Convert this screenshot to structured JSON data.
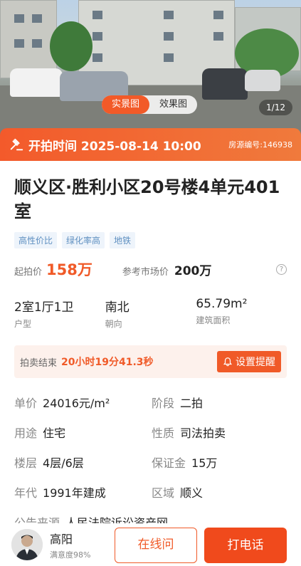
{
  "gallery": {
    "tabs": [
      "实景图",
      "效果图"
    ],
    "active_tab": "实景图",
    "counter": "1/12"
  },
  "auction": {
    "start_label": "开拍时间",
    "start_time": "2025-08-14 10:00",
    "listing_id": "房源编号:146938"
  },
  "listing": {
    "title": "顺义区·胜利小区20号楼4单元401室",
    "tags": [
      "高性价比",
      "绿化率高",
      "地铁"
    ]
  },
  "price": {
    "start_label": "起拍价",
    "start_value": "158万",
    "ref_label": "参考市场价",
    "ref_value": "200万",
    "color": "#f05a28"
  },
  "specs": [
    {
      "value": "2室1厅1卫",
      "label": "户型"
    },
    {
      "value": "南北",
      "label": "朝向"
    },
    {
      "value": "65.79m²",
      "label": "建筑面积"
    }
  ],
  "countdown": {
    "label": "拍卖结束",
    "value": "20小时19分41.3秒",
    "remind_label": "设置提醒"
  },
  "details": [
    {
      "key": "单价",
      "value": "24016元/m²"
    },
    {
      "key": "阶段",
      "value": "二拍"
    },
    {
      "key": "用途",
      "value": "住宅"
    },
    {
      "key": "性质",
      "value": "司法拍卖"
    },
    {
      "key": "楼层",
      "value": "4层/6层"
    },
    {
      "key": "保证金",
      "value": "15万"
    },
    {
      "key": "年代",
      "value": "1991年建成"
    },
    {
      "key": "区域",
      "value": "顺义"
    }
  ],
  "notice_source": {
    "key": "公告来源",
    "value": "人民法院诉讼资产网"
  },
  "agent": {
    "name": "高阳",
    "satisfaction": "满意度98%"
  },
  "actions": {
    "online": "在线问",
    "call": "打电话"
  }
}
